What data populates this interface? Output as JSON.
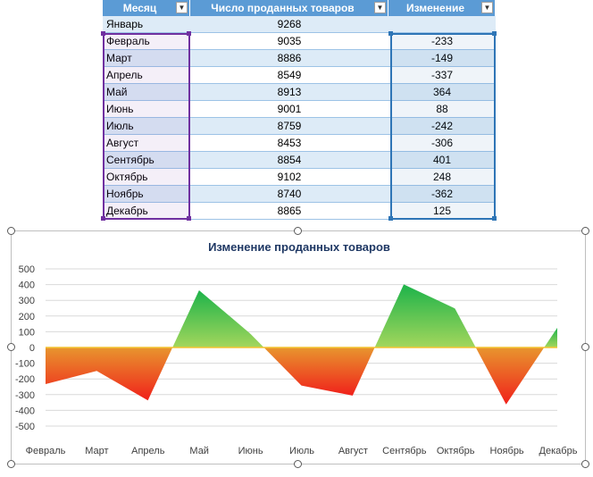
{
  "table": {
    "headers": [
      "Месяц",
      "Число проданных товаров",
      "Изменение"
    ],
    "dropdown_icon": "chevron-down-icon",
    "rows": [
      {
        "month": "Январь",
        "sold": "9268",
        "change": ""
      },
      {
        "month": "Февраль",
        "sold": "9035",
        "change": "-233"
      },
      {
        "month": "Март",
        "sold": "8886",
        "change": "-149"
      },
      {
        "month": "Апрель",
        "sold": "8549",
        "change": "-337"
      },
      {
        "month": "Май",
        "sold": "8913",
        "change": "364"
      },
      {
        "month": "Июнь",
        "sold": "9001",
        "change": "88"
      },
      {
        "month": "Июль",
        "sold": "8759",
        "change": "-242"
      },
      {
        "month": "Август",
        "sold": "8453",
        "change": "-306"
      },
      {
        "month": "Сентябрь",
        "sold": "8854",
        "change": "401"
      },
      {
        "month": "Октябрь",
        "sold": "9102",
        "change": "248"
      },
      {
        "month": "Ноябрь",
        "sold": "8740",
        "change": "-362"
      },
      {
        "month": "Декабрь",
        "sold": "8865",
        "change": "125"
      }
    ],
    "colors": {
      "header": "#5b9bd5",
      "band": "#ddebf7",
      "sel_month": "#7030a0",
      "sel_change": "#2e75b6"
    }
  },
  "chart_data": {
    "type": "area",
    "title": "Изменение проданных товаров",
    "categories": [
      "Февраль",
      "Март",
      "Апрель",
      "Май",
      "Июнь",
      "Июль",
      "Август",
      "Сентябрь",
      "Октябрь",
      "Ноябрь",
      "Декабрь"
    ],
    "values": [
      -233,
      -149,
      -337,
      364,
      88,
      -242,
      -306,
      401,
      248,
      -362,
      125
    ],
    "ylim": [
      -500,
      500
    ],
    "yticks": [
      500,
      400,
      300,
      200,
      100,
      0,
      -100,
      -200,
      -300,
      -400,
      -500
    ],
    "grid": true,
    "positive_gradient": [
      "#1db34a",
      "#a3d65c"
    ],
    "negative_gradient": [
      "#e8952e",
      "#f0211b"
    ],
    "axis_line": "#f4c430"
  }
}
